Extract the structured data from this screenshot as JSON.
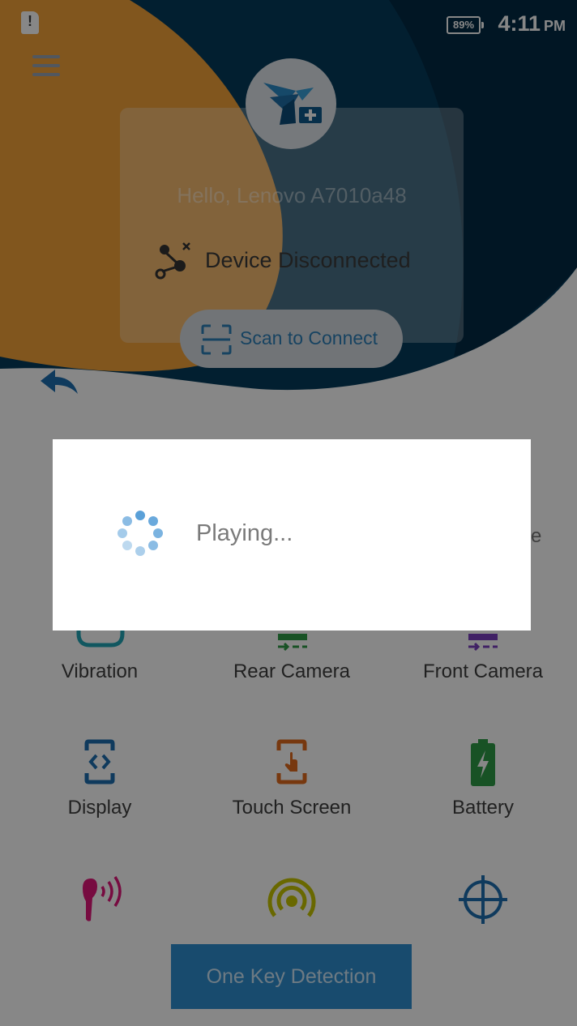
{
  "status_bar": {
    "battery": "89%",
    "time": "4:11",
    "ampm": "PM"
  },
  "header": {
    "greeting": "Hello, Lenovo A7010a48",
    "connection_status": "Device Disconnected",
    "scan_label": "Scan to Connect"
  },
  "grid": {
    "row1": [
      "Vibration",
      "Rear Camera",
      "Front Camera"
    ],
    "row2": [
      "Display",
      "Touch Screen",
      "Battery"
    ]
  },
  "partial_label": "e",
  "primary_button": "One Key Detection",
  "dialog": {
    "message": "Playing..."
  },
  "colors": {
    "navy": "#053b5c",
    "orange": "#f3a23a",
    "accent": "#2f8fd0"
  },
  "icons": [
    "sim-alert-icon",
    "battery-icon",
    "menu-icon",
    "app-logo-icon",
    "disconnected-icon",
    "scan-icon",
    "back-icon",
    "vibration-icon",
    "rear-camera-icon",
    "front-camera-icon",
    "display-icon",
    "touch-screen-icon",
    "battery-test-icon",
    "earpiece-icon",
    "signal-icon",
    "crosshair-icon",
    "loading-spinner-icon"
  ]
}
